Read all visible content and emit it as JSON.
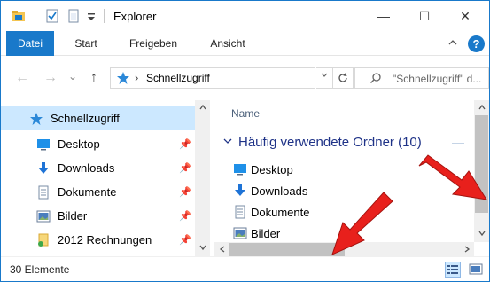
{
  "window": {
    "title": "Explorer",
    "controls": {
      "minimize": "—",
      "maximize": "☐",
      "close": "✕"
    }
  },
  "ribbon": {
    "tabs": [
      "Datei",
      "Start",
      "Freigeben",
      "Ansicht"
    ],
    "help": "?"
  },
  "navigation": {
    "back": "←",
    "forward": "→",
    "recent": "⌄",
    "up": "↑",
    "address_sep": "›",
    "address": "Schnellzugriff",
    "search_placeholder": "\"Schnellzugriff\" d..."
  },
  "sidebar": {
    "items": [
      {
        "label": "Schnellzugriff",
        "icon": "star-icon",
        "selected": true
      },
      {
        "label": "Desktop",
        "icon": "desktop-icon",
        "pinned": true
      },
      {
        "label": "Downloads",
        "icon": "download-icon",
        "pinned": true
      },
      {
        "label": "Dokumente",
        "icon": "document-icon",
        "pinned": true
      },
      {
        "label": "Bilder",
        "icon": "pictures-icon",
        "pinned": true
      },
      {
        "label": "2012 Rechnungen",
        "icon": "folder-icon",
        "pinned": true
      }
    ]
  },
  "content": {
    "column_name": "Name",
    "group_title": "Häufig verwendete Ordner (10)",
    "items": [
      "Desktop",
      "Downloads",
      "Dokumente",
      "Bilder"
    ]
  },
  "status": {
    "count": "30 Elemente"
  },
  "colors": {
    "accent": "#1979ca",
    "selection": "#cce8ff",
    "arrow_red": "#e8201c"
  }
}
